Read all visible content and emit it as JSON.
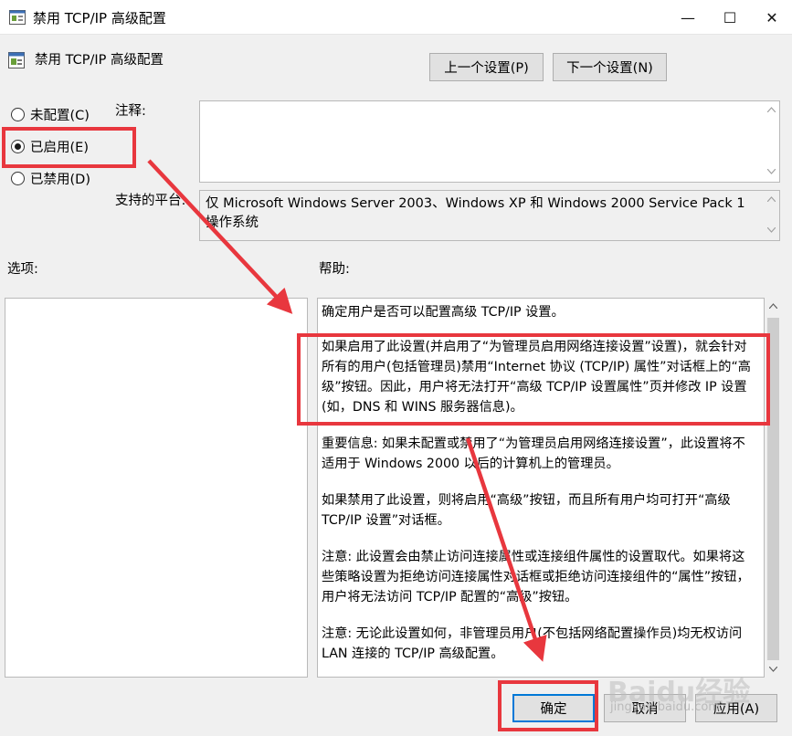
{
  "window": {
    "title": "禁用 TCP/IP 高级配置",
    "minimize_glyph": "—",
    "maximize_glyph": "☐",
    "close_glyph": "✕"
  },
  "policy": {
    "name": "禁用 TCP/IP 高级配置",
    "prev_button": "上一个设置(P)",
    "next_button": "下一个设置(N)"
  },
  "state": {
    "options": [
      {
        "label": "未配置(C)",
        "selected": false
      },
      {
        "label": "已启用(E)",
        "selected": true
      },
      {
        "label": "已禁用(D)",
        "selected": false
      }
    ]
  },
  "labels": {
    "comment": "注释:",
    "platform": "支持的平台:",
    "options": "选项:",
    "help": "帮助:"
  },
  "comment_value": "",
  "platform_text": "仅 Microsoft Windows Server 2003、Windows XP 和 Windows 2000 Service Pack 1 操作系统",
  "help": {
    "paragraphs": [
      "确定用户是否可以配置高级 TCP/IP 设置。",
      "如果启用了此设置(并启用了“为管理员启用网络连接设置”设置)，就会针对所有的用户(包括管理员)禁用“Internet 协议 (TCP/IP) 属性”对话框上的“高级”按钮。因此，用户将无法打开“高级 TCP/IP 设置属性”页并修改 IP 设置(如，DNS 和 WINS 服务器信息)。",
      "重要信息: 如果未配置或禁用了“为管理员启用网络连接设置”，此设置将不适用于 Windows 2000 以后的计算机上的管理员。",
      "如果禁用了此设置，则将启用“高级”按钮，而且所有用户均可打开“高级 TCP/IP 设置”对话框。",
      "注意: 此设置会由禁止访问连接属性或连接组件属性的设置取代。如果将这些策略设置为拒绝访问连接属性对话框或拒绝访问连接组件的“属性”按钮，用户将无法访问 TCP/IP 配置的“高级”按钮。",
      "注意: 无论此设置如何，非管理员用户(不包括网络配置操作员)均无权访问 LAN 连接的 TCP/IP 高级配置。"
    ]
  },
  "buttons": {
    "ok": "确定",
    "cancel": "取消",
    "apply": "应用(A)"
  },
  "watermark": {
    "brand": "Baidu经验",
    "url": "jingyan.baidu.com"
  },
  "colors": {
    "annotation": "#e8373e",
    "focus": "#0078d7"
  }
}
